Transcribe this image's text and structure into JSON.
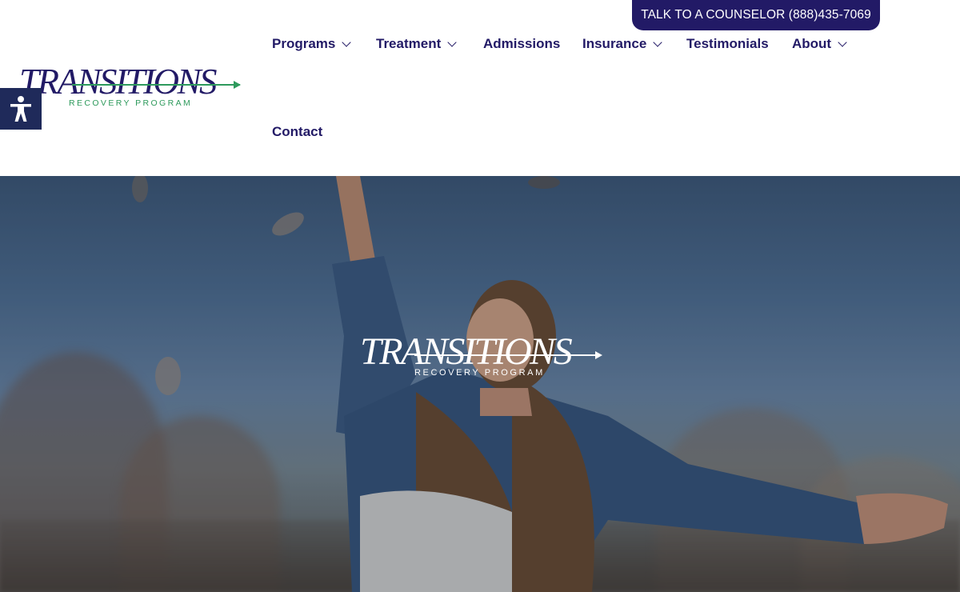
{
  "header": {
    "cta_label": "TALK TO A COUNSELOR (888)435-7069",
    "logo": {
      "wordmark": "TRANSITIONS",
      "tagline": "RECOVERY PROGRAM"
    },
    "nav": {
      "programs": "Programs",
      "treatment": "Treatment",
      "admissions": "Admissions",
      "insurance": "Insurance",
      "testimonials": "Testimonials",
      "about": "About",
      "contact": "Contact"
    }
  },
  "hero": {
    "logo": {
      "wordmark": "TRANSITIONS",
      "tagline": "RECOVERY PROGRAM"
    }
  },
  "colors": {
    "brand_navy": "#221a66",
    "brand_green": "#2e9a5c",
    "accessibility_button": "#1f2a5a"
  },
  "icons": {
    "accessibility": "accessibility-person-icon",
    "dropdown": "chevron-down-icon"
  }
}
